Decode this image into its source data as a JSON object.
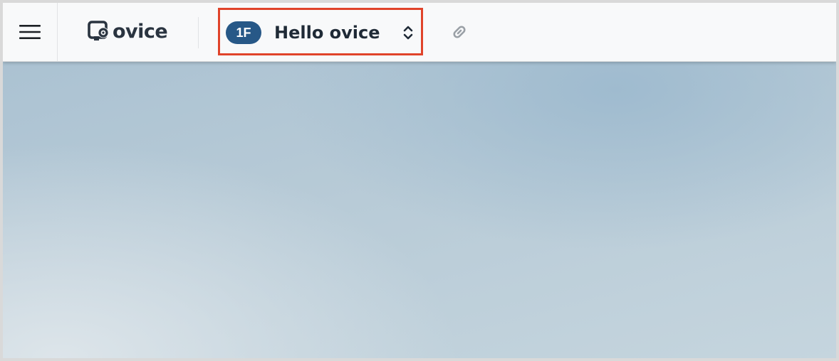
{
  "app": {
    "logo_text": "ovice"
  },
  "header": {
    "menu_icon": "hamburger-icon",
    "room_selector": {
      "floor_badge": "1F",
      "room_name": "Hello ovice",
      "expand_icon": "chevron-up-down-icon"
    },
    "link_icon": "link-icon"
  },
  "colors": {
    "highlight_border": "#e0432a",
    "floor_badge_bg": "#275887",
    "logo_text": "#2a3440",
    "topbar_bg": "#f8f9fa",
    "canvas_bg": "#b5c8d5"
  }
}
